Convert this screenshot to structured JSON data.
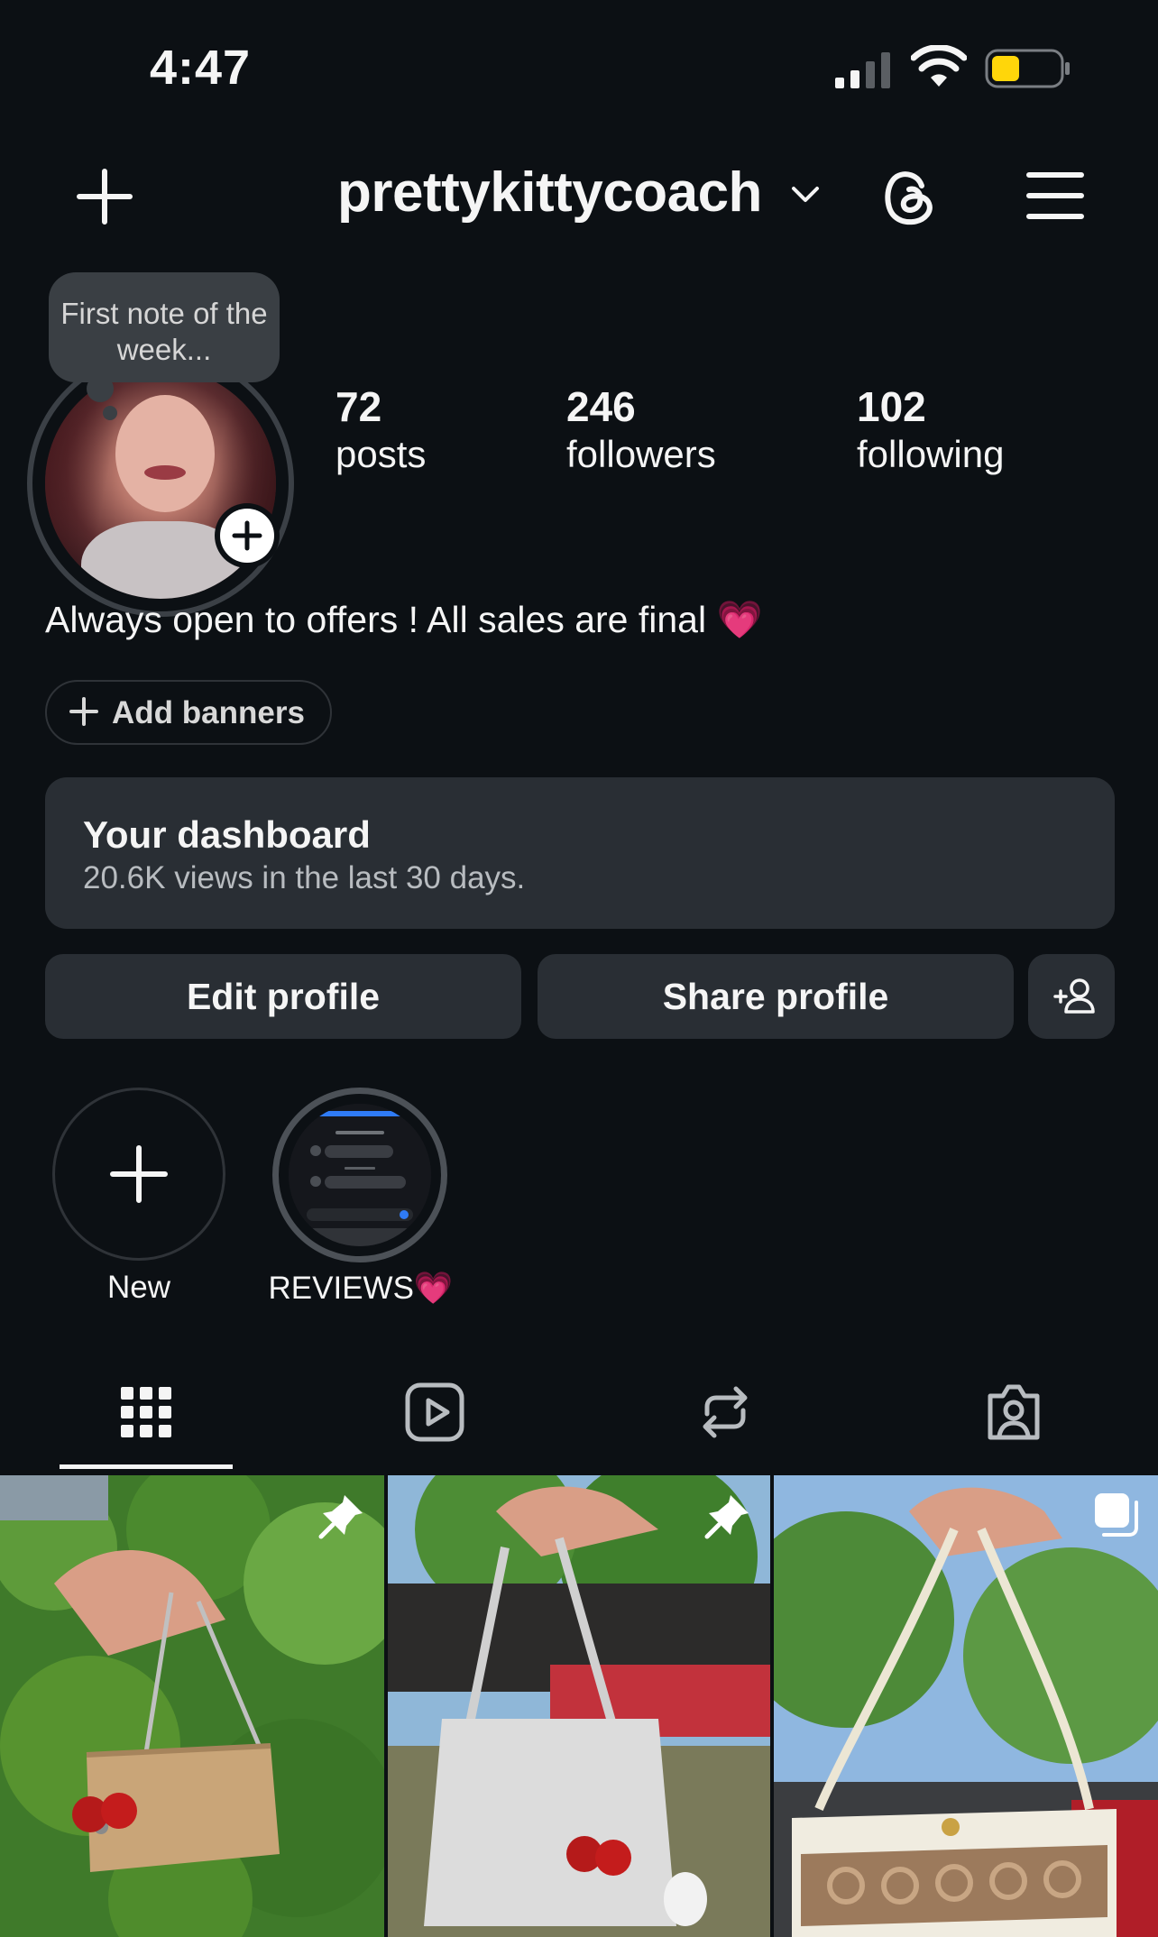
{
  "status_bar": {
    "time": "4:47"
  },
  "header": {
    "username": "prettykittycoach"
  },
  "note": {
    "text": "First note of the week..."
  },
  "stats": [
    {
      "count": "72",
      "label": "posts"
    },
    {
      "count": "246",
      "label": "followers"
    },
    {
      "count": "102",
      "label": "following"
    }
  ],
  "bio": {
    "text": "Always open to offers ! All sales are final 💗"
  },
  "banners": {
    "label": "Add banners"
  },
  "dashboard": {
    "title": "Your dashboard",
    "subtitle": "20.6K views in the last 30 days."
  },
  "buttons": {
    "edit": "Edit profile",
    "share": "Share profile"
  },
  "highlights": [
    {
      "label": "New"
    },
    {
      "label": "REVIEWS💗"
    }
  ],
  "tabs": [
    "grid-icon",
    "reels-icon",
    "reposts-icon",
    "tagged-icon"
  ],
  "colors": {
    "background": "#0c1014",
    "surface": "#292e34",
    "text": "#f5f5f5",
    "battery": "#ffd60a"
  }
}
